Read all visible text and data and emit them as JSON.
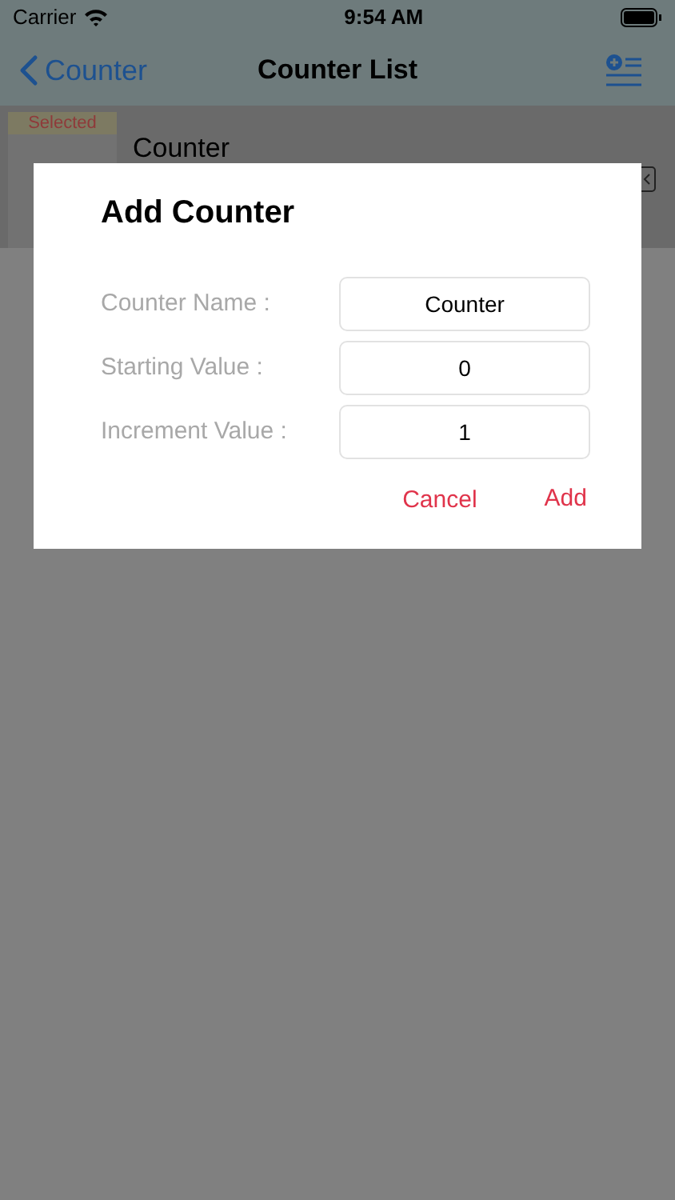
{
  "status_bar": {
    "carrier": "Carrier",
    "time": "9:54 AM"
  },
  "nav": {
    "back": "Counter",
    "title": "Counter List"
  },
  "list": [
    {
      "badge": "Selected",
      "name": "Counter",
      "selected": true
    }
  ],
  "dialog": {
    "title": "Add Counter",
    "fields": [
      {
        "label": "Counter Name :",
        "value": "Counter"
      },
      {
        "label": "Starting Value :",
        "value": "0"
      },
      {
        "label": "Increment Value :",
        "value": "1"
      }
    ],
    "buttons": [
      "Cancel",
      "Add"
    ]
  }
}
